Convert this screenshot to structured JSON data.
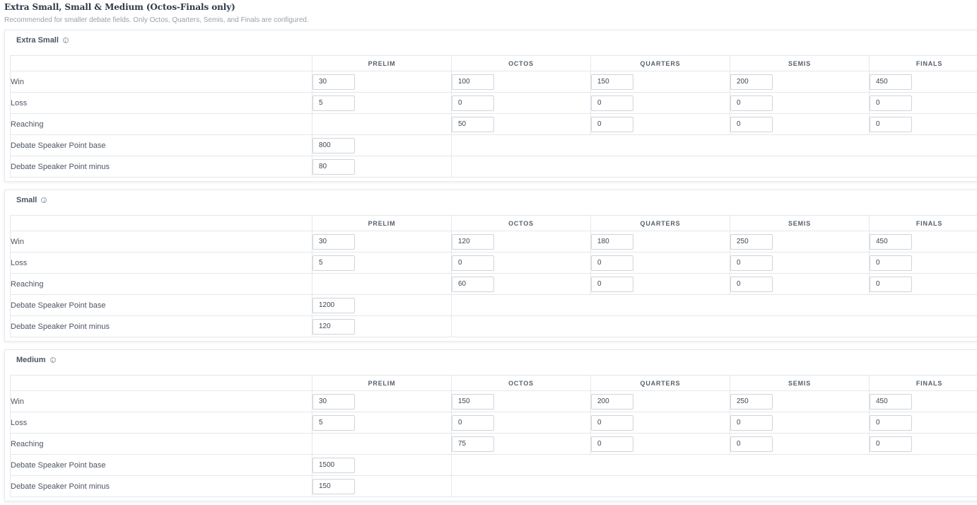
{
  "page": {
    "title": "Extra Small, Small & Medium (Octos-Finals only)",
    "subtitle": "Recommended for smaller debate fields. Only Octos, Quarters, Semis, and Finals are configured."
  },
  "columns": [
    "PRELIM",
    "OCTOS",
    "QUARTERS",
    "SEMIS",
    "FINALS"
  ],
  "row_labels": {
    "win": "Win",
    "loss": "Loss",
    "reaching": "Reaching",
    "sp_base": "Debate Speaker Point base",
    "sp_minus": "Debate Speaker Point minus"
  },
  "sections": [
    {
      "name": "Extra Small",
      "win": [
        "30",
        "100",
        "150",
        "200",
        "450"
      ],
      "loss": [
        "5",
        "0",
        "0",
        "0",
        "0"
      ],
      "reaching": [
        "50",
        "0",
        "0",
        "0"
      ],
      "sp_base": "800",
      "sp_minus": "80"
    },
    {
      "name": "Small",
      "win": [
        "30",
        "120",
        "180",
        "250",
        "450"
      ],
      "loss": [
        "5",
        "0",
        "0",
        "0",
        "0"
      ],
      "reaching": [
        "60",
        "0",
        "0",
        "0"
      ],
      "sp_base": "1200",
      "sp_minus": "120"
    },
    {
      "name": "Medium",
      "win": [
        "30",
        "150",
        "200",
        "250",
        "450"
      ],
      "loss": [
        "5",
        "0",
        "0",
        "0",
        "0"
      ],
      "reaching": [
        "75",
        "0",
        "0",
        "0"
      ],
      "sp_base": "1500",
      "sp_minus": "150"
    }
  ]
}
